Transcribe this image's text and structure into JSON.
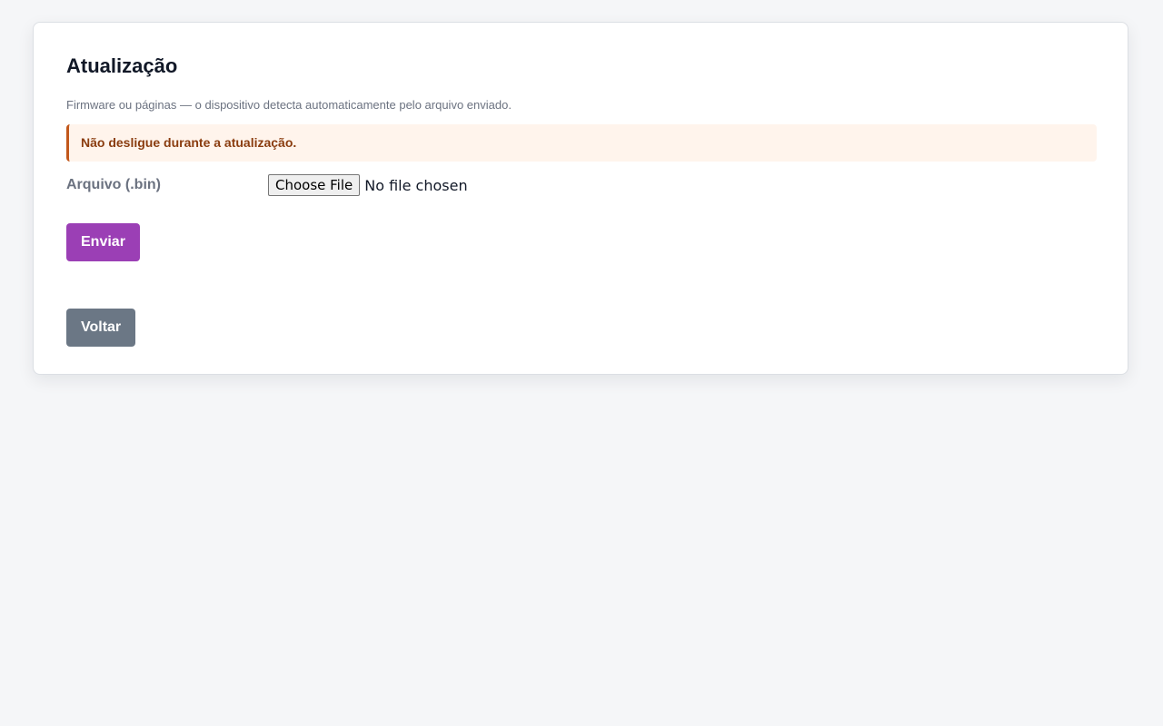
{
  "page": {
    "title": "Atualização",
    "subtitle": "Firmware ou páginas — o dispositivo detecta automaticamente pelo arquivo enviado.",
    "warning": "Não desligue durante a atualização."
  },
  "form": {
    "file_label": "Arquivo (.bin)",
    "file_button_label": "Choose File",
    "file_status": "No file chosen"
  },
  "actions": {
    "submit_label": "Enviar",
    "back_label": "Voltar"
  },
  "colors": {
    "primary_button": "#9b3fb5",
    "secondary_button": "#6b7785",
    "warning_background": "#fff4ec",
    "warning_accent": "#c2571a",
    "warning_text": "#8a3c0f"
  }
}
